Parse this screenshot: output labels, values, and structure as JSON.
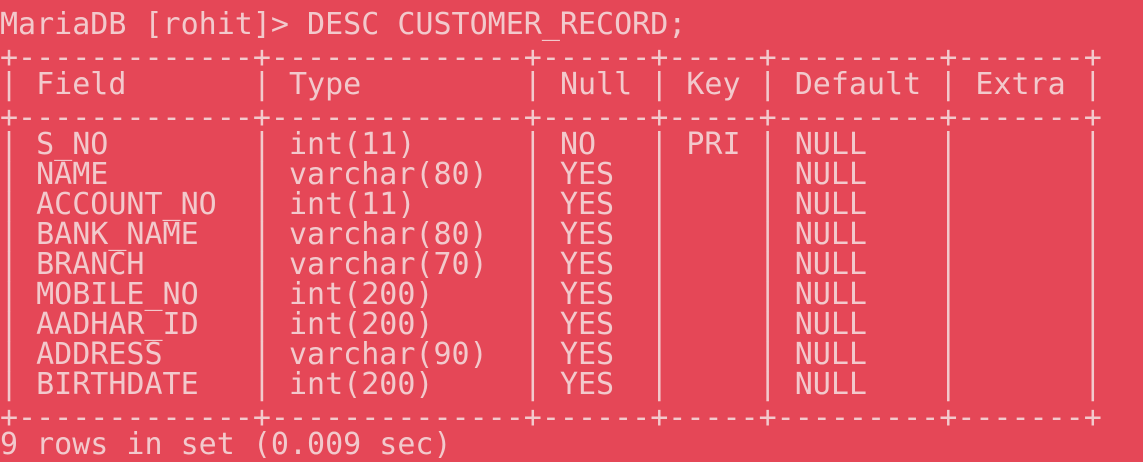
{
  "terminal": {
    "prompt": "MariaDB [rohit]> ",
    "command": "DESC CUSTOMER_RECORD;",
    "border_line": "+-------------+--------------+------+-----+---------+-------+",
    "headers": [
      "Field",
      "Type",
      "Null",
      "Key",
      "Default",
      "Extra"
    ],
    "rows": [
      [
        "S_NO",
        "int(11)",
        "NO",
        "PRI",
        "NULL",
        ""
      ],
      [
        "NAME",
        "varchar(80)",
        "YES",
        "",
        "NULL",
        ""
      ],
      [
        "ACCOUNT_NO",
        "int(11)",
        "YES",
        "",
        "NULL",
        ""
      ],
      [
        "BANK_NAME",
        "varchar(80)",
        "YES",
        "",
        "NULL",
        ""
      ],
      [
        "BRANCH",
        "varchar(70)",
        "YES",
        "",
        "NULL",
        ""
      ],
      [
        "MOBILE_NO",
        "int(200)",
        "YES",
        "",
        "NULL",
        ""
      ],
      [
        "AADHAR_ID",
        "int(200)",
        "YES",
        "",
        "NULL",
        ""
      ],
      [
        "ADDRESS",
        "varchar(90)",
        "YES",
        "",
        "NULL",
        ""
      ],
      [
        "BIRTHDATE",
        "int(200)",
        "YES",
        "",
        "NULL",
        ""
      ]
    ],
    "footer": "9 rows in set (0.009 sec)",
    "colors": {
      "background": "#e54757",
      "text": "#f2c9cc"
    }
  }
}
